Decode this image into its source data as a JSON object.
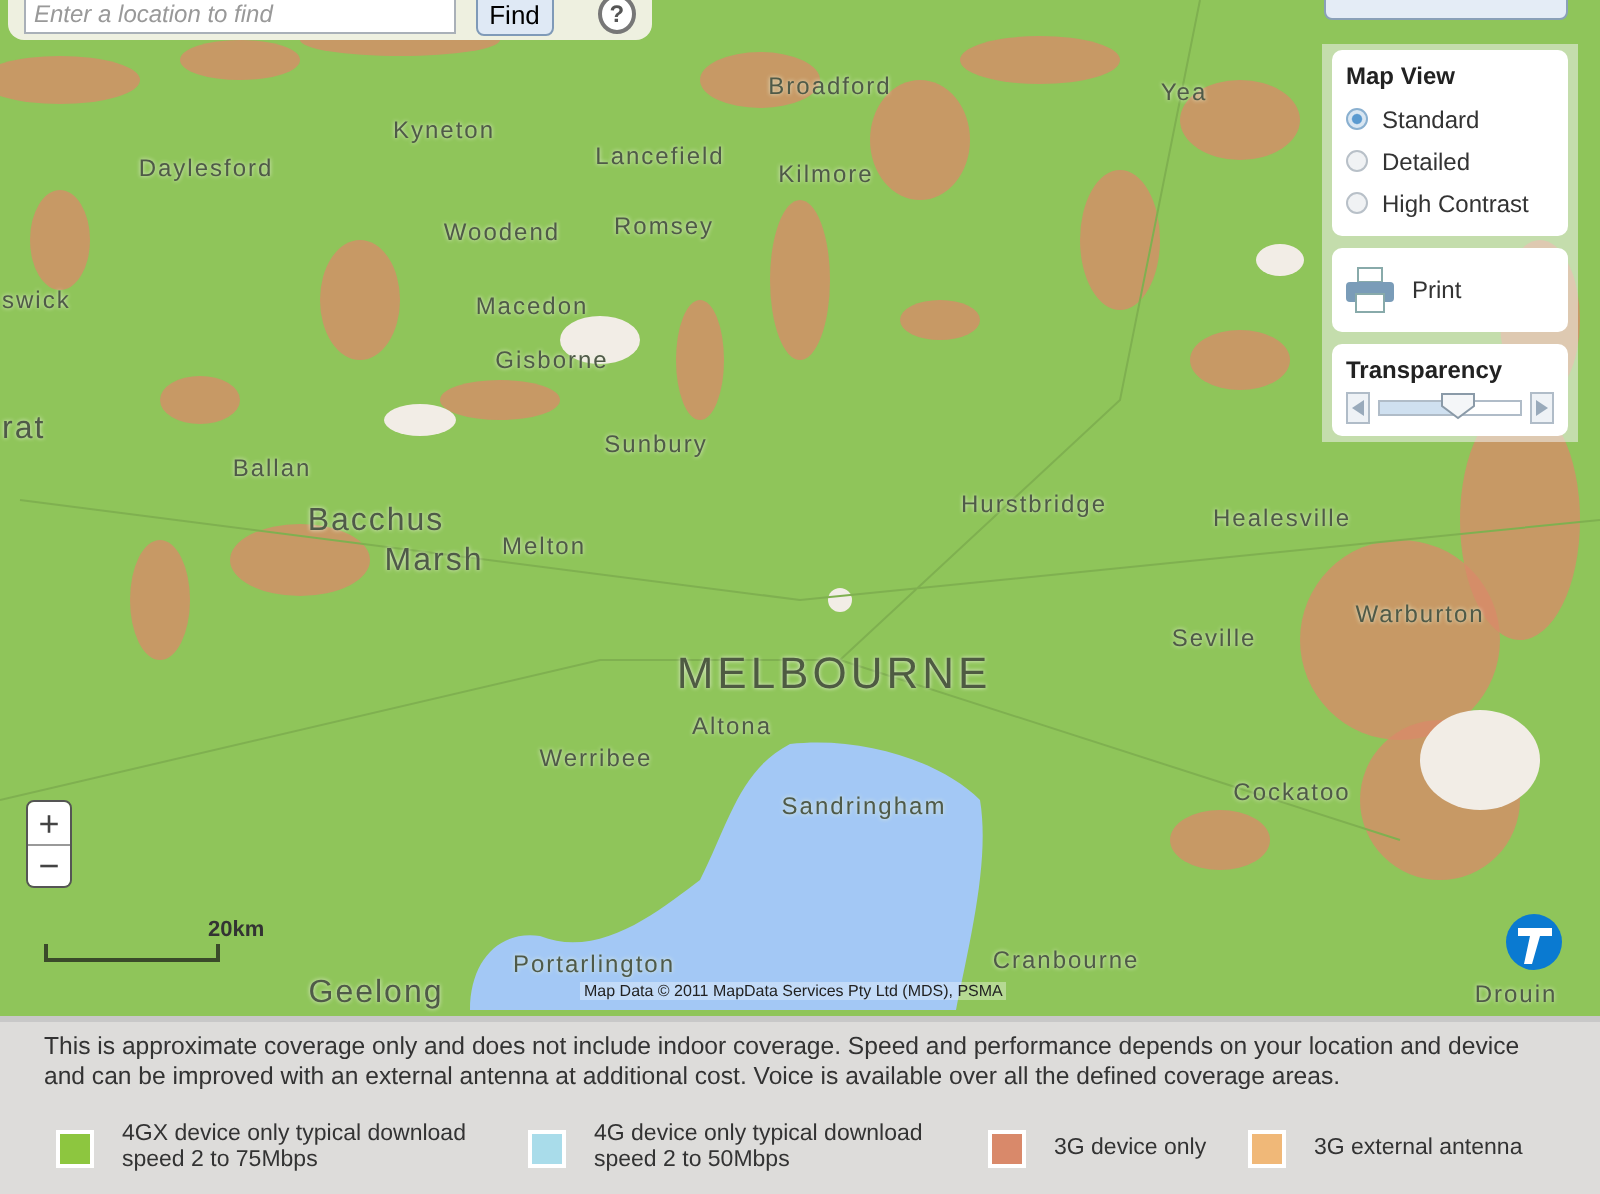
{
  "search": {
    "placeholder": "Enter a location to find",
    "button": "Find",
    "help": "?"
  },
  "map_view": {
    "title": "Map View",
    "options": [
      {
        "label": "Standard",
        "selected": true
      },
      {
        "label": "Detailed",
        "selected": false
      },
      {
        "label": "High Contrast",
        "selected": false
      }
    ]
  },
  "print": {
    "label": "Print"
  },
  "transparency": {
    "title": "Transparency",
    "level": 0.55
  },
  "zoom": {
    "in": "+",
    "out": "−"
  },
  "scale": "20km",
  "places": [
    {
      "name": "Broadford",
      "kind": "town"
    },
    {
      "name": "Kyneton",
      "kind": "town"
    },
    {
      "name": "Lancefield",
      "kind": "town"
    },
    {
      "name": "Yea",
      "kind": "town"
    },
    {
      "name": "Kilmore",
      "kind": "town"
    },
    {
      "name": "Daylesford",
      "kind": "town"
    },
    {
      "name": "Woodend",
      "kind": "town"
    },
    {
      "name": "Romsey",
      "kind": "town"
    },
    {
      "name": "swick",
      "kind": "town"
    },
    {
      "name": "Macedon",
      "kind": "town"
    },
    {
      "name": "Gisborne",
      "kind": "town"
    },
    {
      "name": "rat",
      "kind": "large"
    },
    {
      "name": "Sunbury",
      "kind": "town"
    },
    {
      "name": "Ballan",
      "kind": "town"
    },
    {
      "name": "Bacchus",
      "kind": "large"
    },
    {
      "name": "Hurstbridge",
      "kind": "town"
    },
    {
      "name": "Healesville",
      "kind": "town"
    },
    {
      "name": "Marsh",
      "kind": "large"
    },
    {
      "name": "Melton",
      "kind": "town"
    },
    {
      "name": "MELBOURNE",
      "kind": "city"
    },
    {
      "name": "Warburton",
      "kind": "town"
    },
    {
      "name": "Seville",
      "kind": "town"
    },
    {
      "name": "Altona",
      "kind": "town"
    },
    {
      "name": "Werribee",
      "kind": "town"
    },
    {
      "name": "Sandringham",
      "kind": "town"
    },
    {
      "name": "Cockatoo",
      "kind": "town"
    },
    {
      "name": "Portarlington",
      "kind": "town"
    },
    {
      "name": "Cranbourne",
      "kind": "town"
    },
    {
      "name": "Geelong",
      "kind": "large"
    },
    {
      "name": "Drouin",
      "kind": "town"
    }
  ],
  "attribution": "Map Data © 2011 MapData Services Pty Ltd (MDS), PSMA",
  "legend": {
    "note": "This is approximate coverage only and does not include indoor coverage. Speed and performance depends on your location and device and can be improved with an external antenna at additional cost. Voice is available over all the defined coverage areas.",
    "items": [
      {
        "label": "4GX device only typical download speed 2 to 75Mbps",
        "color": "#8dc63f"
      },
      {
        "label": "4G device only typical download speed 2 to 50Mbps",
        "color": "#a9dcea"
      },
      {
        "label": "3G device only",
        "color": "#d9896a"
      },
      {
        "label": "3G external antenna",
        "color": "#f0b878"
      }
    ]
  }
}
